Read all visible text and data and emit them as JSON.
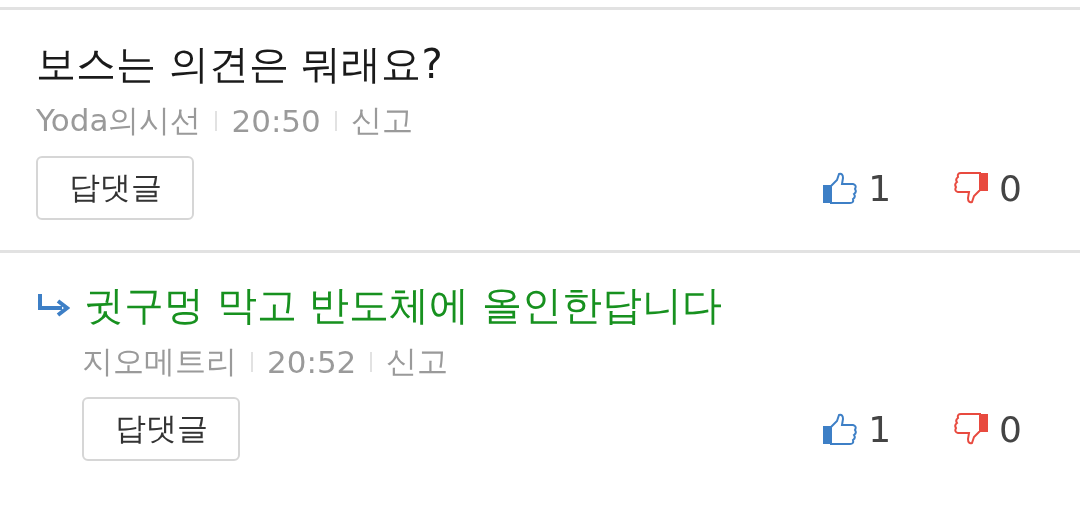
{
  "comments": [
    {
      "kind": "comment",
      "text": "보스는 의견은 뭐래요?",
      "author": "Yoda의시선",
      "time": "20:50",
      "report": "신고",
      "reply_button": "답댓글",
      "likes": "1",
      "dislikes": "0"
    },
    {
      "kind": "reply",
      "text": "귓구멍 막고 반도체에 올인한답니다",
      "author": "지오메트리",
      "time": "20:52",
      "report": "신고",
      "reply_button": "답댓글",
      "likes": "1",
      "dislikes": "0"
    }
  ]
}
